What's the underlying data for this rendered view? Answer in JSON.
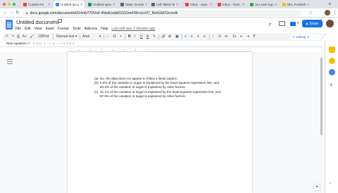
{
  "browser": {
    "tabs": [
      {
        "title": "Content Fo",
        "color": "#ea4335"
      },
      {
        "title": "Untitled docum",
        "color": "#4285f4",
        "active": true
      },
      {
        "title": "Untitled spread",
        "color": "#0f9d58"
      },
      {
        "title": "Stats: Goodnes",
        "color": "#5f6368"
      },
      {
        "title": "Left Tailed Te",
        "color": "#5f6368"
      },
      {
        "title": "Inbox - ssmi...",
        "color": "#ea4335"
      },
      {
        "title": "Inbox - hsmi...",
        "color": "#ea4335"
      },
      {
        "title": "16 Least Squa",
        "color": "#34a853"
      },
      {
        "title": "NFL Football",
        "color": "#fbbc04"
      }
    ],
    "new_tab_label": "+",
    "url": "docs.google.com/document/d/1Hm6i77DVoF-4NzdUctdri0XZZmrrFMcr/yvVi7_f6xKlJkFGrc/edit"
  },
  "doc": {
    "title": "Untitled document",
    "menus": [
      "File",
      "Edit",
      "View",
      "Insert",
      "Format",
      "Tools",
      "Add-ons",
      "Help"
    ],
    "last_edit": "Last edit was 2 minutes ago",
    "share_label": "Share"
  },
  "toolbar": {
    "zoom": "100%",
    "style": "Normal text",
    "font": "Arial",
    "size": "11",
    "bold": "B",
    "italic": "I",
    "underline": "U",
    "text_color": "A",
    "mode": "Editing"
  },
  "equation_bar": {
    "new_equation": "New equation",
    "symbols": "αβΓ ▾  ≤≥≠ ▾  ÷× ▾  ⇔⇒ ▾  ∀∃ ▾"
  },
  "ruler": {
    "marks": "· · · 1 · · · 2 · · · 3 · · · 4 · · · 5 · · · 6 · · · 7"
  },
  "answers": [
    {
      "label": "(a)",
      "text": "No, the data does not appear to follow a linear pattern"
    },
    {
      "label": "(b)",
      "text": "6.8% of the variation in sugar is explained by the least-squares regression line, and 93.2% of the variation in sugar is explained by other factors."
    },
    {
      "label": "(c)",
      "text": "42.1% of the variation in sugar is explained by the least-squares regression line, and 57.9% of the variation in sugar is explained by other factors."
    }
  ],
  "colors": {
    "accent": "#1a73e8",
    "docs_blue": "#4285f4",
    "side_calendar": "#fbbc04",
    "side_keep": "#fbbc04",
    "side_tasks": "#4285f4"
  }
}
